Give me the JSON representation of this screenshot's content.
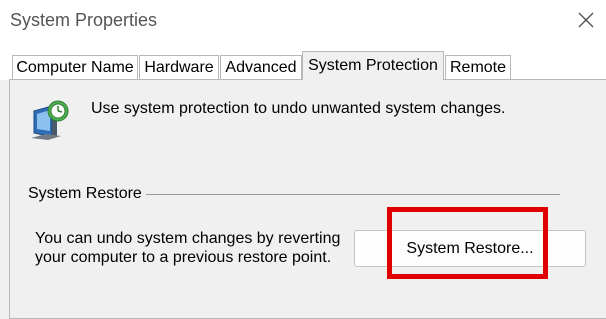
{
  "window": {
    "title": "System Properties",
    "close_icon": "close-icon"
  },
  "tabs": [
    {
      "label": "Computer Name",
      "active": false
    },
    {
      "label": "Hardware",
      "active": false
    },
    {
      "label": "Advanced",
      "active": false
    },
    {
      "label": "System Protection",
      "active": true
    },
    {
      "label": "Remote",
      "active": false
    }
  ],
  "protection": {
    "icon": "system-protection-icon",
    "intro": "Use system protection to undo unwanted system changes."
  },
  "system_restore": {
    "group_label": "System Restore",
    "description_line1": "You can undo system changes by reverting",
    "description_line2": "your computer to a previous restore point.",
    "button_label": "System Restore...",
    "highlight_color": "#e00000"
  }
}
